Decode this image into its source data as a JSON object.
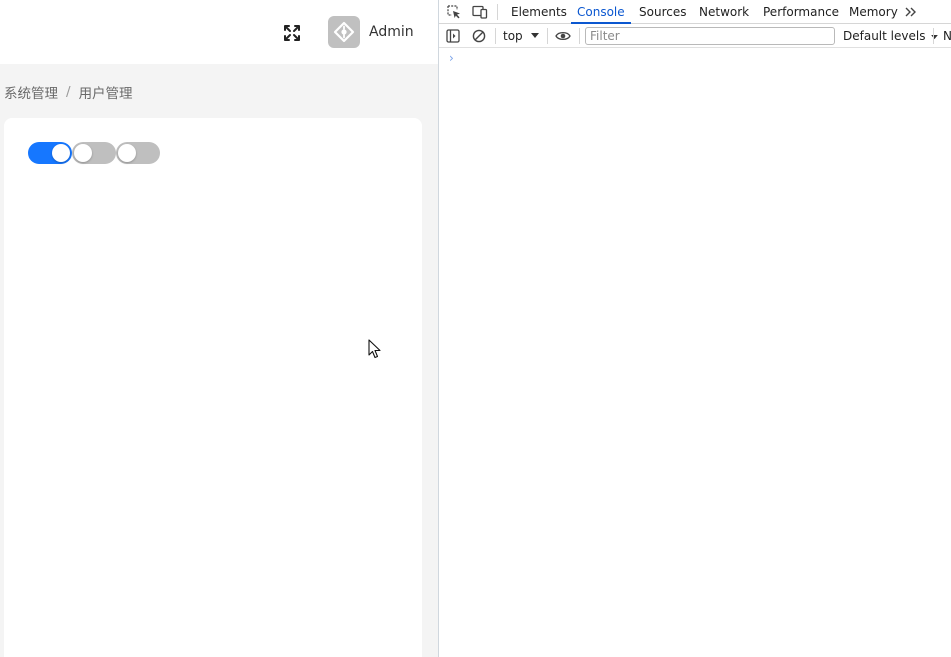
{
  "app": {
    "header": {
      "fullscreen_icon": "fullscreen-icon",
      "avatar_icon": "diamond-logo-icon",
      "username": "Admin"
    },
    "breadcrumb": {
      "items": [
        "系统管理",
        "用户管理"
      ],
      "separator": "/"
    },
    "switches": [
      {
        "state": "on"
      },
      {
        "state": "off"
      },
      {
        "state": "off"
      }
    ],
    "colors": {
      "switch_on": "#1677ff",
      "switch_off": "#bfbfbf",
      "avatar_bg": "#c0c0c0",
      "content_bg": "#f4f4f4"
    }
  },
  "devtools": {
    "tabs": [
      "Elements",
      "Console",
      "Sources",
      "Network",
      "Performance",
      "Memory"
    ],
    "active_tab": "Console",
    "more_tabs_icon": "chevron-double-right-icon",
    "context": "top",
    "filter_placeholder": "Filter",
    "levels": "Default levels",
    "truncated_label": "N",
    "prompt_glyph": "›",
    "accent": "#0b57d0"
  }
}
